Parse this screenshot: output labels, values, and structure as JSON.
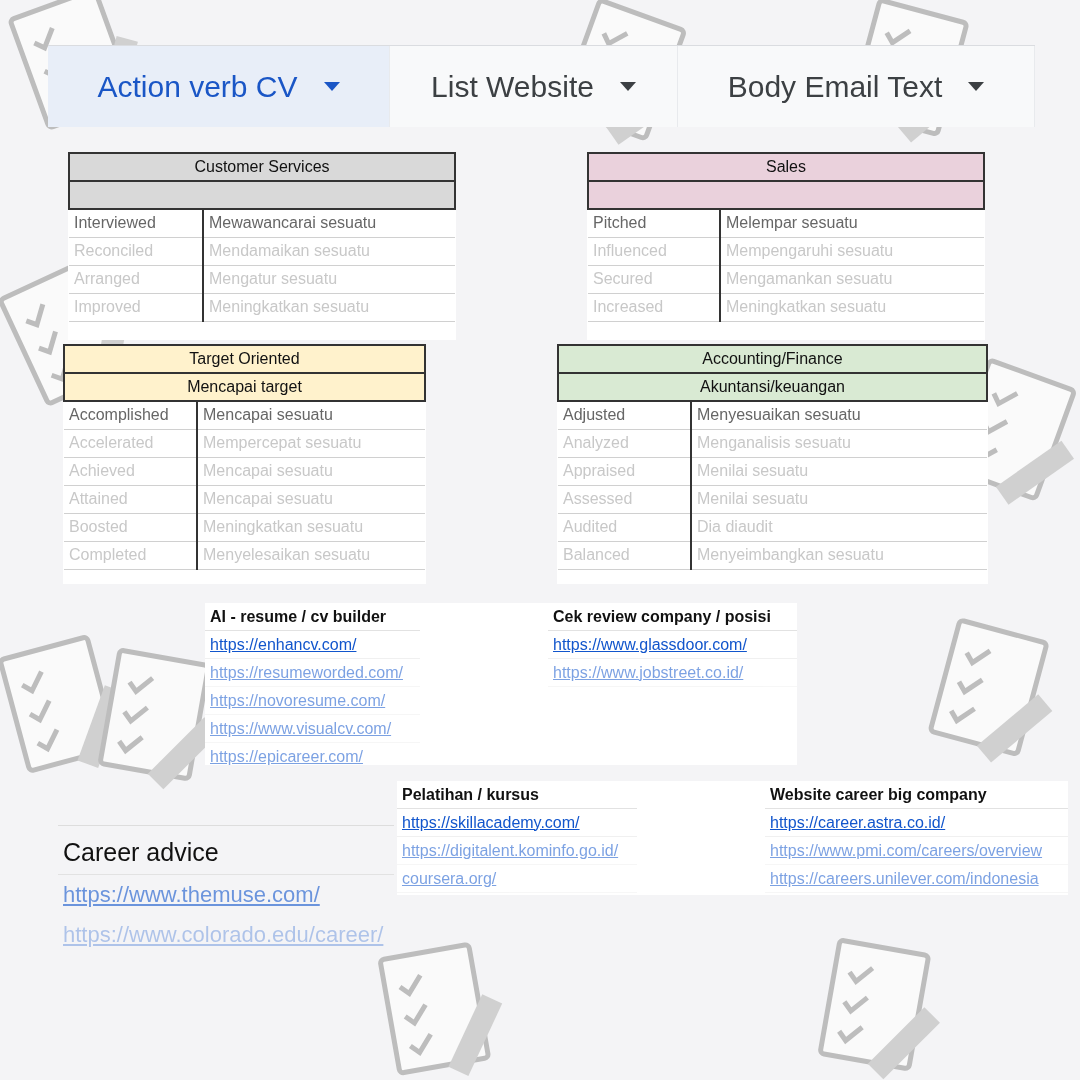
{
  "tabs": [
    {
      "label": "Action verb CV",
      "selected": true
    },
    {
      "label": "List Website",
      "selected": false
    },
    {
      "label": "Body Email Text",
      "selected": false
    }
  ],
  "verb_tables": [
    {
      "title": "Customer Services",
      "color": "#d9d9d9",
      "rows": [
        [
          "Interviewed",
          "Mewawancarai sesuatu"
        ],
        [
          "Reconciled",
          "Mendamaikan sesuatu"
        ],
        [
          "Arranged",
          "Mengatur sesuatu"
        ],
        [
          "Improved",
          "Meningkatkan sesuatu"
        ]
      ]
    },
    {
      "title": "Sales",
      "color": "#ead1dc",
      "rows": [
        [
          "Pitched",
          "Melempar sesuatu"
        ],
        [
          "Influenced",
          "Mempengaruhi sesuatu"
        ],
        [
          "Secured",
          "Mengamankan sesuatu"
        ],
        [
          "Increased",
          "Meningkatkan sesuatu"
        ]
      ]
    },
    {
      "title": "Target Oriented",
      "subtitle": "Mencapai target",
      "color": "#fff2cc",
      "rows": [
        [
          "Accomplished",
          "Mencapai sesuatu"
        ],
        [
          "Accelerated",
          "Mempercepat sesuatu"
        ],
        [
          "Achieved",
          "Mencapai sesuatu"
        ],
        [
          "Attained",
          "Mencapai sesuatu"
        ],
        [
          "Boosted",
          "Meningkatkan sesuatu"
        ],
        [
          "Completed",
          "Menyelesaikan sesuatu"
        ]
      ]
    },
    {
      "title": "Accounting/Finance",
      "subtitle": "Akuntansi/keuangan",
      "color": "#d9ead3",
      "rows": [
        [
          "Adjusted",
          "Menyesuaikan sesuatu"
        ],
        [
          "Analyzed",
          "Menganalisis sesuatu"
        ],
        [
          "Appraised",
          "Menilai sesuatu"
        ],
        [
          "Assessed",
          "Menilai sesuatu"
        ],
        [
          "Audited",
          "Dia diaudit"
        ],
        [
          "Balanced",
          "Menyeimbangkan sesuatu"
        ]
      ]
    }
  ],
  "link_tables": [
    {
      "columns": [
        {
          "header": "AI - resume / cv builder",
          "links": [
            "https://enhancv.com/",
            "https://resumeworded.com/",
            "https://novoresume.com/",
            "https://www.visualcv.com/",
            "https://epicareer.com/"
          ]
        },
        {
          "header": "Cek review company / posisi",
          "links": [
            "https://www.glassdoor.com/",
            "https://www.jobstreet.co.id/"
          ]
        }
      ]
    },
    {
      "columns": [
        {
          "header": "Pelatihan / kursus",
          "links": [
            "https://skillacademy.com/",
            "https://digitalent.kominfo.go.id/",
            "coursera.org/"
          ]
        },
        {
          "header": "Website career big company",
          "links": [
            "https://career.astra.co.id/",
            "https://www.pmi.com/careers/overview",
            "https://careers.unilever.com/indonesia"
          ]
        }
      ]
    }
  ],
  "career_advice": {
    "title": "Career advice",
    "links": [
      "https://www.themuse.com/",
      "https://www.colorado.edu/career/"
    ]
  }
}
